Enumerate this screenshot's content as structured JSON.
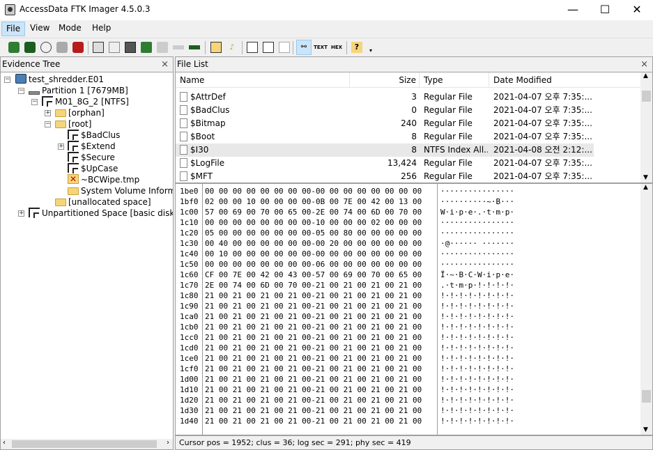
{
  "window": {
    "title": "AccessData FTK Imager 4.5.0.3",
    "minimize": "—",
    "maximize": "☐",
    "close": "✕"
  },
  "menu": [
    "File",
    "View",
    "Mode",
    "Help"
  ],
  "toolbar": {
    "icons": [
      "add-evidence-icon",
      "add-all-evidence-icon",
      "image-mounting-icon",
      "remove-evidence-icon",
      "remove-all-evidence-icon",
      "create-disk-image-icon",
      "export-disk-image-icon",
      "export-logical-image-icon",
      "add-to-custom-content-icon",
      "create-custom-content-image-icon",
      "decrypt-ad1-icon",
      "verify-drive-icon",
      "capture-memory-icon",
      "obtain-protected-files-icon",
      "detect-efs-icon",
      "export-files-icon",
      "export-file-hash-list-icon",
      "export-directory-listing-icon",
      "auto-viewer-icon",
      "text-viewer-icon",
      "hex-viewer-icon",
      "help-icon",
      "dropdown-icon"
    ]
  },
  "evidence_tree": {
    "title": "Evidence Tree",
    "close": "×",
    "items": [
      {
        "label": "test_shredder.E01",
        "icon": "disk-icon"
      },
      {
        "label": "Partition 1 [7679MB]",
        "icon": "partition-icon"
      },
      {
        "label": "M01_8G_2 [NTFS]",
        "icon": "ntfs-volume-icon"
      },
      {
        "label": "[orphan]",
        "icon": "folder-icon"
      },
      {
        "label": "[root]",
        "icon": "folder-icon"
      },
      {
        "label": "$BadClus",
        "icon": "ntfs-volume-icon"
      },
      {
        "label": "$Extend",
        "icon": "ntfs-volume-icon"
      },
      {
        "label": "$Secure",
        "icon": "ntfs-volume-icon"
      },
      {
        "label": "$UpCase",
        "icon": "ntfs-volume-icon"
      },
      {
        "label": "~BCWipe.tmp",
        "icon": "deleted-folder-icon"
      },
      {
        "label": "System Volume Inform",
        "icon": "folder-icon"
      },
      {
        "label": "[unallocated space]",
        "icon": "folder-icon"
      },
      {
        "label": "Unpartitioned Space [basic disk]",
        "icon": "ntfs-volume-icon"
      }
    ]
  },
  "file_list": {
    "title": "File List",
    "close": "×",
    "columns": [
      "Name",
      "Size",
      "Type",
      "Date Modified"
    ],
    "rows": [
      {
        "name": "$AttrDef",
        "size": "3",
        "type": "Regular File",
        "date": "2021-04-07 오후 7:35:..."
      },
      {
        "name": "$BadClus",
        "size": "0",
        "type": "Regular File",
        "date": "2021-04-07 오후 7:35:..."
      },
      {
        "name": "$Bitmap",
        "size": "240",
        "type": "Regular File",
        "date": "2021-04-07 오후 7:35:..."
      },
      {
        "name": "$Boot",
        "size": "8",
        "type": "Regular File",
        "date": "2021-04-07 오후 7:35:..."
      },
      {
        "name": "$I30",
        "size": "8",
        "type": "NTFS Index All...",
        "date": "2021-04-08 오전 2:12:..."
      },
      {
        "name": "$LogFile",
        "size": "13,424",
        "type": "Regular File",
        "date": "2021-04-07 오후 7:35:..."
      },
      {
        "name": "$MFT",
        "size": "256",
        "type": "Regular File",
        "date": "2021-04-07 오후 7:35:..."
      }
    ]
  },
  "hex": {
    "rows": [
      {
        "addr": "1be0",
        "bytes": "00 00 00 00 00 00 00 00-00 00 00 00 00 00 00 00",
        "ascii": "················"
      },
      {
        "addr": "1bf0",
        "bytes": "02 00 00 10 00 00 00 00-0B 00 7E 00 42 00 13 00",
        "ascii": "··········~·B···"
      },
      {
        "addr": "1c00",
        "bytes": "57 00 69 00 70 00 65 00-2E 00 74 00 6D 00 70 00",
        "ascii": "W·i·p·e·.·t·m·p·"
      },
      {
        "addr": "1c10",
        "bytes": "00 00 00 00 00 00 00 00-10 00 00 00 02 00 00 00",
        "ascii": "················"
      },
      {
        "addr": "1c20",
        "bytes": "05 00 00 00 00 00 00 00-05 00 80 00 00 00 00 00",
        "ascii": "················"
      },
      {
        "addr": "1c30",
        "bytes": "00 40 00 00 00 00 00 00-00 20 00 00 00 00 00 00",
        "ascii": "·@······ ·······"
      },
      {
        "addr": "1c40",
        "bytes": "00 10 00 00 00 00 00 00-00 00 00 00 00 00 00 00",
        "ascii": "················"
      },
      {
        "addr": "1c50",
        "bytes": "00 00 00 00 00 00 00 00-06 00 00 00 00 00 00 00",
        "ascii": "················"
      },
      {
        "addr": "1c60",
        "bytes": "CF 00 7E 00 42 00 43 00-57 00 69 00 70 00 65 00",
        "ascii": "Ï·~·B·C·W·i·p·e·"
      },
      {
        "addr": "1c70",
        "bytes": "2E 00 74 00 6D 00 70 00-21 00 21 00 21 00 21 00",
        "ascii": ".·t·m·p·!·!·!·!·"
      },
      {
        "addr": "1c80",
        "bytes": "21 00 21 00 21 00 21 00-21 00 21 00 21 00 21 00",
        "ascii": "!·!·!·!·!·!·!·!·"
      },
      {
        "addr": "1c90",
        "bytes": "21 00 21 00 21 00 21 00-21 00 21 00 21 00 21 00",
        "ascii": "!·!·!·!·!·!·!·!·"
      },
      {
        "addr": "1ca0",
        "bytes": "21 00 21 00 21 00 21 00-21 00 21 00 21 00 21 00",
        "ascii": "!·!·!·!·!·!·!·!·"
      },
      {
        "addr": "1cb0",
        "bytes": "21 00 21 00 21 00 21 00-21 00 21 00 21 00 21 00",
        "ascii": "!·!·!·!·!·!·!·!·"
      },
      {
        "addr": "1cc0",
        "bytes": "21 00 21 00 21 00 21 00-21 00 21 00 21 00 21 00",
        "ascii": "!·!·!·!·!·!·!·!·"
      },
      {
        "addr": "1cd0",
        "bytes": "21 00 21 00 21 00 21 00-21 00 21 00 21 00 21 00",
        "ascii": "!·!·!·!·!·!·!·!·"
      },
      {
        "addr": "1ce0",
        "bytes": "21 00 21 00 21 00 21 00-21 00 21 00 21 00 21 00",
        "ascii": "!·!·!·!·!·!·!·!·"
      },
      {
        "addr": "1cf0",
        "bytes": "21 00 21 00 21 00 21 00-21 00 21 00 21 00 21 00",
        "ascii": "!·!·!·!·!·!·!·!·"
      },
      {
        "addr": "1d00",
        "bytes": "21 00 21 00 21 00 21 00-21 00 21 00 21 00 21 00",
        "ascii": "!·!·!·!·!·!·!·!·"
      },
      {
        "addr": "1d10",
        "bytes": "21 00 21 00 21 00 21 00-21 00 21 00 21 00 21 00",
        "ascii": "!·!·!·!·!·!·!·!·"
      },
      {
        "addr": "1d20",
        "bytes": "21 00 21 00 21 00 21 00-21 00 21 00 21 00 21 00",
        "ascii": "!·!·!·!·!·!·!·!·"
      },
      {
        "addr": "1d30",
        "bytes": "21 00 21 00 21 00 21 00-21 00 21 00 21 00 21 00",
        "ascii": "!·!·!·!·!·!·!·!·"
      },
      {
        "addr": "1d40",
        "bytes": "21 00 21 00 21 00 21 00-21 00 21 00 21 00 21 00",
        "ascii": "!·!·!·!·!·!·!·!·"
      }
    ]
  },
  "status": {
    "text": "Cursor pos = 1952; clus = 36; log sec = 291; phy sec = 419"
  },
  "colors": {
    "selected_row": "#e8e8e8",
    "menu_active": "#cce4f7"
  }
}
